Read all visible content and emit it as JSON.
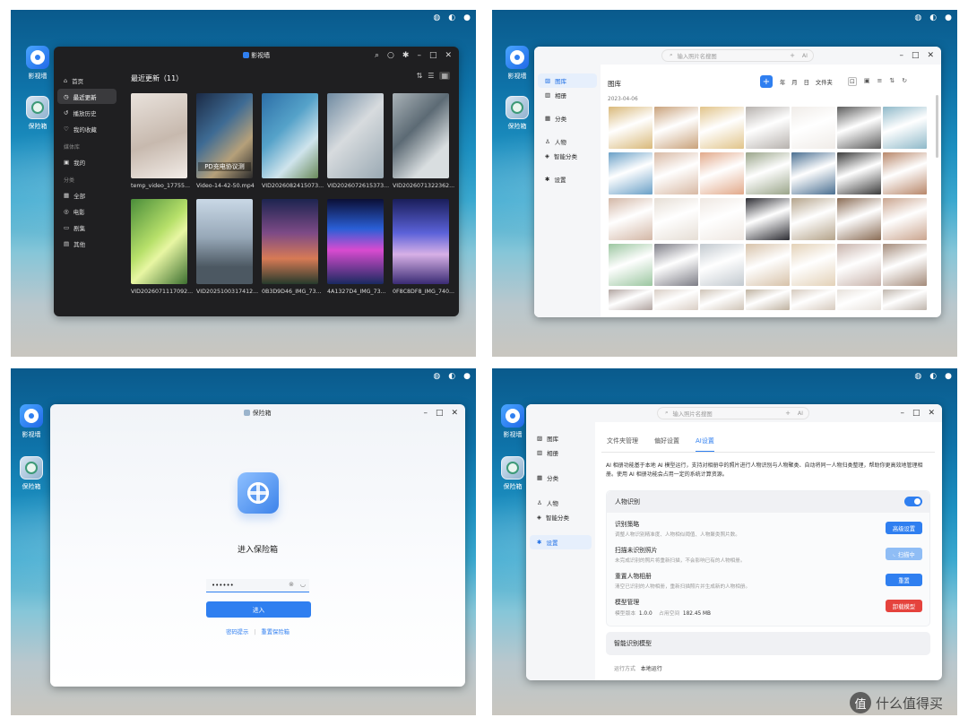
{
  "desktop": {
    "icons": [
      {
        "label": "影视墙",
        "icon": "film-app-icon"
      },
      {
        "label": "保险箱",
        "icon": "safe-app-icon"
      }
    ]
  },
  "p1": {
    "sidebar": {
      "items": [
        "首页",
        "最近更新",
        "播放历史",
        "我的收藏"
      ],
      "section_media": "媒体库",
      "media_items": [
        "我的"
      ],
      "section_category": "分类",
      "category_items": [
        "全部",
        "电影",
        "剧集",
        "其他"
      ]
    },
    "heading": "最近更新（11）",
    "tiles": [
      {
        "caption": "temp_video_17755..."
      },
      {
        "caption": "Video-14-42-50.mp4",
        "overlay": "PD充电协议测"
      },
      {
        "caption": "VID2026082415073..."
      },
      {
        "caption": "VID2026072615373..."
      },
      {
        "caption": "VID2026071322362..."
      },
      {
        "caption": "VID2026071117092..."
      },
      {
        "caption": "VID2025100317412..."
      },
      {
        "caption": "0B3D9D46_IMG_73..."
      },
      {
        "caption": "4A1327D4_IMG_73..."
      },
      {
        "caption": "0F8C8DF8_IMG_740..."
      }
    ]
  },
  "p2": {
    "search_placeholder": "输入照片名搜图",
    "ai_badge": "AI",
    "sidebar": [
      "图库",
      "相册",
      "分类",
      "人物",
      "智能分类",
      "设置"
    ],
    "heading": "图库",
    "add_label": "+",
    "view_buttons": [
      "年",
      "月",
      "日",
      "文件夹"
    ],
    "date": "2023-04-06"
  },
  "p3": {
    "title": "保险箱",
    "heading": "进入保险箱",
    "password_value": "••••••",
    "enter_label": "进入",
    "link_hint": "密码提示",
    "link_sep": "|",
    "link_reset": "重置保险箱"
  },
  "p4": {
    "search_placeholder": "输入照片名搜图",
    "ai_badge": "AI",
    "sidebar": [
      "图库",
      "相册",
      "分类",
      "人物",
      "智能分类",
      "设置"
    ],
    "tabs": [
      "文件夹管理",
      "偏好设置",
      "AI设置"
    ],
    "description": "AI 相册功能基于本地 AI 模型运行，支持对相册中的照片进行人物识别与人物聚类、自动将同一人物归类整理，帮助你更高效地管理相册。使用 AI 相册功能会占用一定的系统计算资源。",
    "section_person": "人物识别",
    "rows": [
      {
        "title": "识别策略",
        "sub": "调整人物识别精准度、人物相似阈值、人物聚类照片数。",
        "button": "高级设置"
      },
      {
        "title": "扫描未识别照片",
        "sub": "未完成识别的照片将重新扫描，不会影响已有的人物相册。",
        "button": "扫描中"
      },
      {
        "title": "重置人物相册",
        "sub": "清空已识别的人物相册，重新扫描照片并生成新的人物相册。",
        "button": "重置"
      },
      {
        "title": "模型管理",
        "sub_label1": "模型版本",
        "sub_value1": "1.0.0",
        "sub_label2": "占用空间",
        "sub_value2": "182.45 MB",
        "button": "卸载模型"
      }
    ],
    "section_smart": "智能识别模型",
    "run_mode_label": "运行方式",
    "run_mode_value": "本地运行"
  },
  "watermark": {
    "glyph": "值",
    "text": "什么值得买"
  },
  "colors": {
    "accent": "#2f7ff0",
    "danger": "#e5433d",
    "dark_window": "#1f1f21"
  }
}
